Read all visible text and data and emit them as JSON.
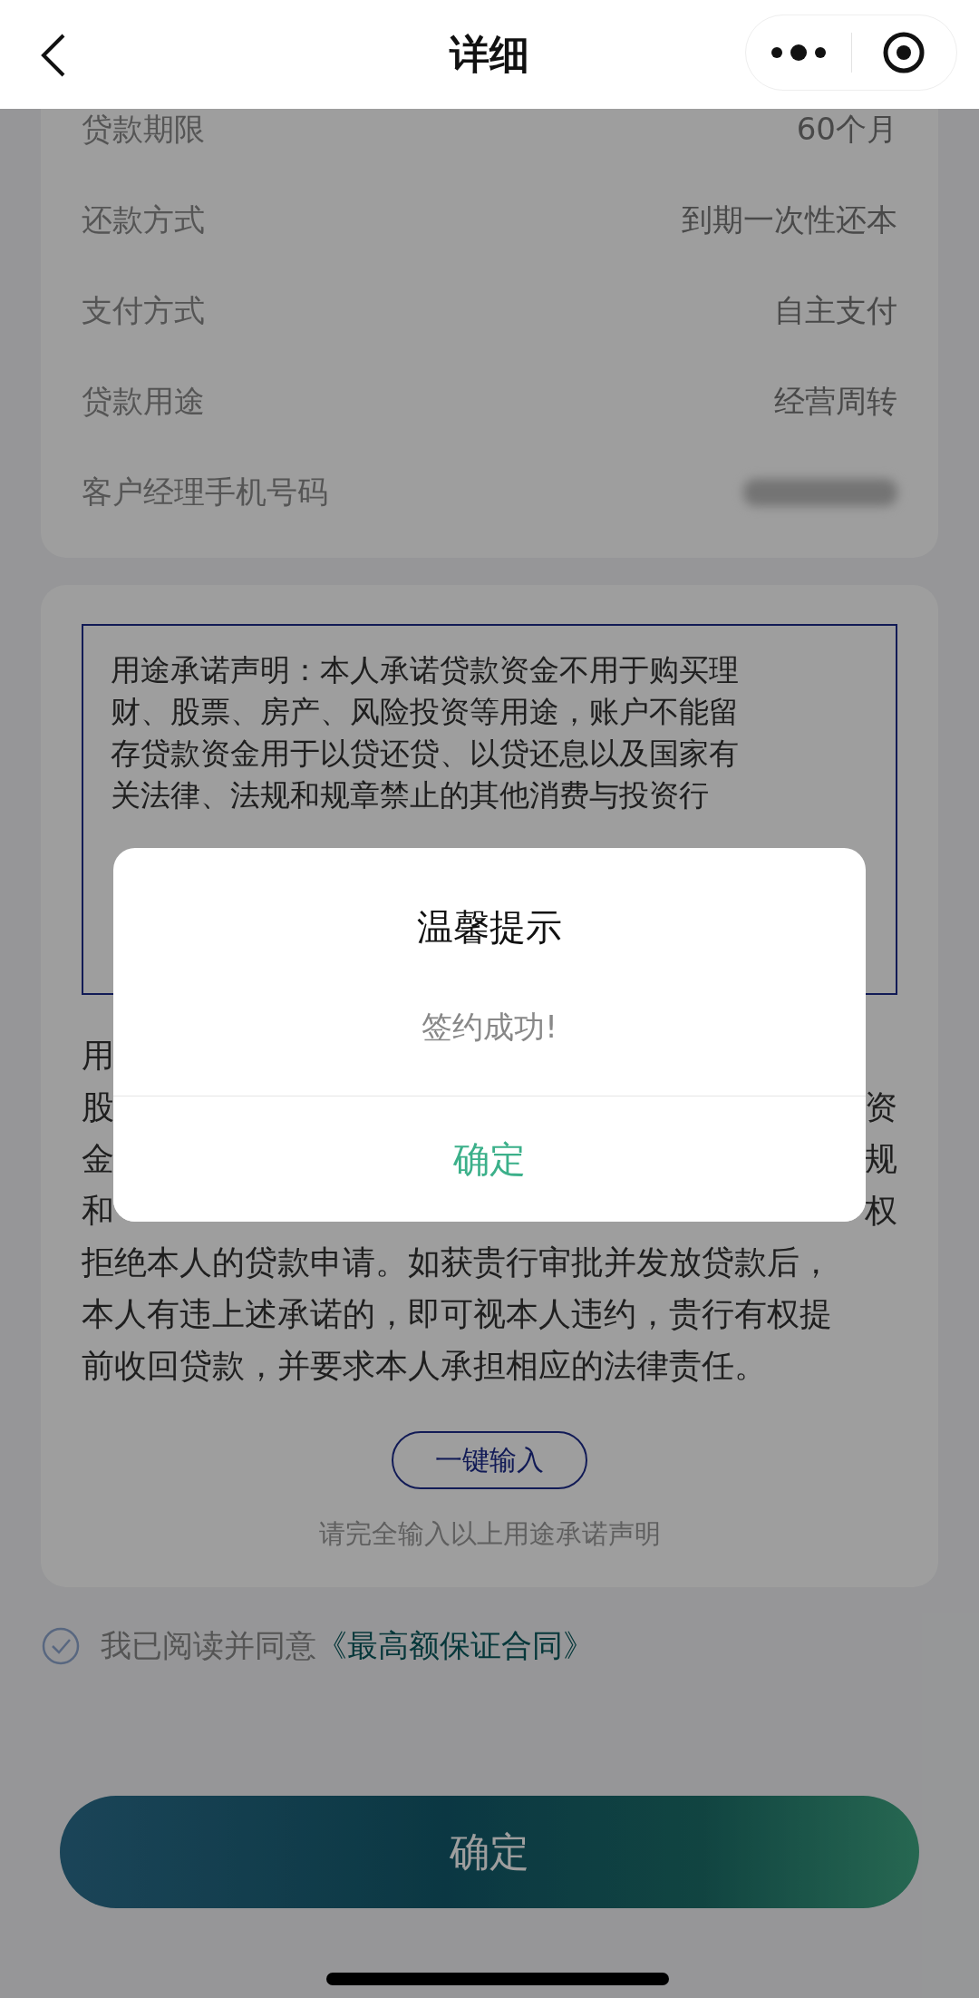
{
  "header": {
    "title": "详细"
  },
  "details": [
    {
      "label": "贷款期限",
      "value": "60个月"
    },
    {
      "label": "还款方式",
      "value": "到期一次性还本"
    },
    {
      "label": "支付方式",
      "value": "自主支付"
    },
    {
      "label": "贷款用途",
      "value": "经营周转"
    },
    {
      "label": "客户经理手机号码",
      "kind": "redacted"
    }
  ],
  "statement_box": {
    "lines": [
      "用途承诺声明：本人承诺贷款资金不用于购买理",
      "财、股票、房产、风险投资等用途，账户不能留",
      "存贷款资金用于以贷还贷、以贷还息以及国家有",
      "关法律、法规和规章禁止的其他消费与投资行"
    ]
  },
  "statement_text": {
    "partial_lines": [
      {
        "left": "用"
      },
      {
        "left": "股",
        "right": "资"
      },
      {
        "left": "金",
        "right": "规"
      },
      {
        "left": "和",
        "right": "权"
      }
    ],
    "lines": [
      "拒绝本人的贷款申请。如获贵行审批并发放贷款后，",
      "本人有违上述承诺的，即可视本人违约，贵行有权提",
      "前收回贷款，并要求本人承担相应的法律责任。"
    ]
  },
  "fill_button": "一键输入",
  "hint": "请完全输入以上用途承诺声明",
  "agreement": {
    "checked": true,
    "text": "我已阅读并同意",
    "link": "《最高额保证合同》"
  },
  "confirm_button": "确定",
  "dialog": {
    "title": "温馨提示",
    "message": "签约成功!",
    "button": "确定"
  }
}
